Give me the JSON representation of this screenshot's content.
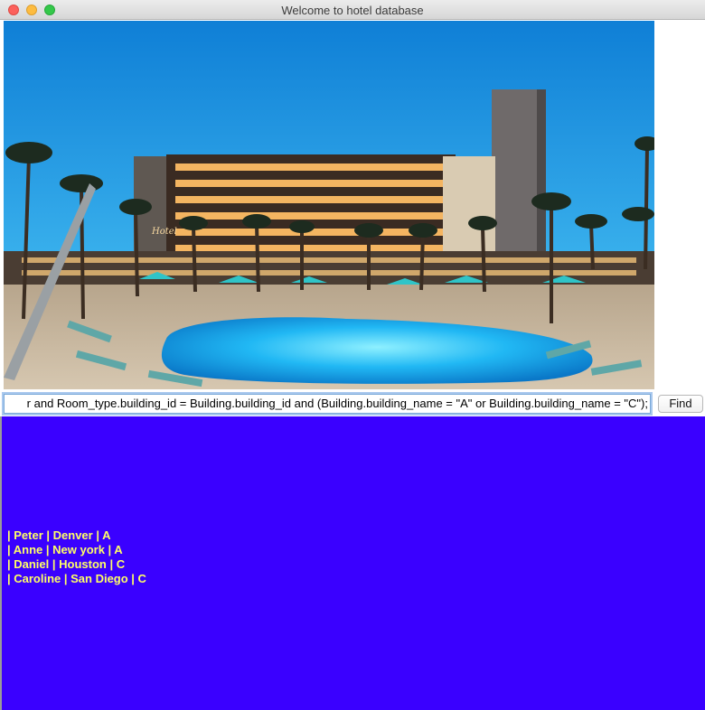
{
  "window": {
    "title": "Welcome to hotel database"
  },
  "query": {
    "value": "r and Room_type.building_id = Building.building_id and (Building.building_name = \"A\" or Building.building_name = \"C\");"
  },
  "toolbar": {
    "find_label": "Find"
  },
  "results": {
    "rows": [
      "| Peter | Denver | A",
      "| Anne | New york | A",
      "| Daniel | Houston | C",
      "| Caroline | San Diego | C"
    ]
  },
  "image": {
    "sign_text": "Hotel"
  },
  "colors": {
    "results_background": "#3a00ff",
    "results_text": "#ffff66",
    "sky": "#1f9fe6",
    "pool": "#23b6f2"
  }
}
